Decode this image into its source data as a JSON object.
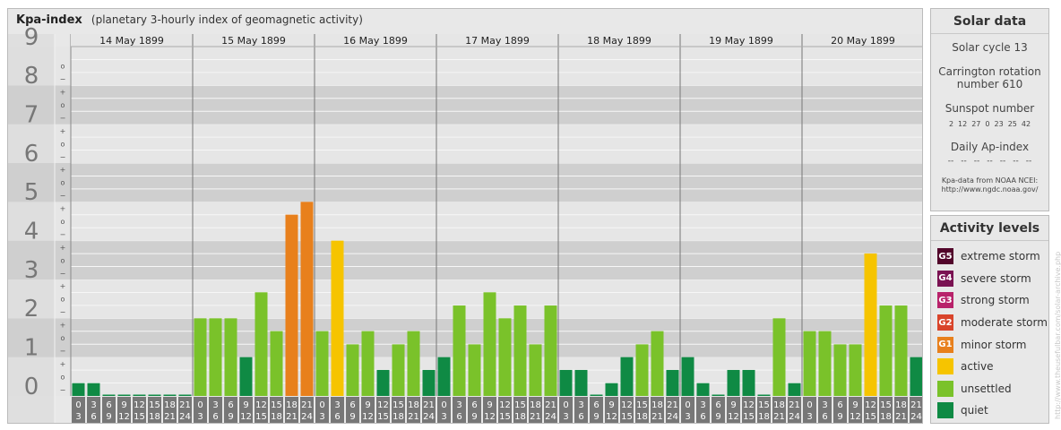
{
  "header": {
    "title": "Kpa-index",
    "subtitle": "(planetary 3-hourly index of geomagnetic activity)"
  },
  "chart_data": {
    "type": "bar",
    "title": "Kpa-index",
    "subtitle": "(planetary 3-hourly index of geomagnetic activity)",
    "ylim": [
      0,
      9
    ],
    "y_tick_labels": [
      "0",
      "1",
      "2",
      "3",
      "4",
      "5",
      "6",
      "7",
      "8",
      "9"
    ],
    "y_minor_labels": [
      "−",
      "o",
      "+"
    ],
    "days": [
      "14 May 1899",
      "15 May 1899",
      "16 May 1899",
      "17 May 1899",
      "18 May 1899",
      "19 May 1899",
      "20 May 1899"
    ],
    "interval_start_labels": [
      "0",
      "3",
      "6",
      "9",
      "12",
      "15",
      "18",
      "21"
    ],
    "interval_end_labels": [
      "3",
      "6",
      "9",
      "12",
      "15",
      "18",
      "21",
      "24"
    ],
    "series": [
      {
        "values": [
          0.33,
          0.33,
          0,
          0,
          0,
          0,
          0,
          0,
          2.0,
          2.0,
          2.0,
          1.0,
          2.67,
          1.67,
          4.67,
          5.0,
          1.67,
          4.0,
          1.33,
          1.67,
          0.67,
          1.33,
          1.67,
          0.67,
          1.0,
          2.33,
          1.33,
          2.67,
          2.0,
          2.33,
          1.33,
          2.33,
          0.67,
          0.67,
          0,
          0.33,
          1.0,
          1.33,
          1.67,
          0.67,
          1.0,
          0.33,
          0,
          0.67,
          0.67,
          0,
          2.0,
          0.33,
          1.67,
          1.67,
          1.33,
          1.33,
          3.67,
          2.33,
          2.33,
          1.0
        ],
        "levels": [
          "quiet",
          "quiet",
          "quiet",
          "quiet",
          "quiet",
          "quiet",
          "quiet",
          "quiet",
          "unsettled",
          "unsettled",
          "unsettled",
          "quiet",
          "unsettled",
          "unsettled",
          "minor",
          "minor",
          "unsettled",
          "active",
          "unsettled",
          "unsettled",
          "quiet",
          "unsettled",
          "unsettled",
          "quiet",
          "quiet",
          "unsettled",
          "unsettled",
          "unsettled",
          "unsettled",
          "unsettled",
          "unsettled",
          "unsettled",
          "quiet",
          "quiet",
          "quiet",
          "quiet",
          "quiet",
          "unsettled",
          "unsettled",
          "quiet",
          "quiet",
          "quiet",
          "quiet",
          "quiet",
          "quiet",
          "quiet",
          "unsettled",
          "quiet",
          "unsettled",
          "unsettled",
          "unsettled",
          "unsettled",
          "active",
          "unsettled",
          "unsettled",
          "quiet"
        ]
      }
    ],
    "level_colors": {
      "quiet": "#0f8a44",
      "unsettled": "#7ac22a",
      "active": "#f6c400",
      "minor": "#e8801c",
      "moderate": "#d9442a",
      "strong": "#b8226a",
      "severe": "#7a1252",
      "extreme": "#52052a"
    },
    "grid": true,
    "legend_position": "right"
  },
  "solar": {
    "title": "Solar data",
    "cycle": "Solar cycle 13",
    "carrington_line1": "Carrington rotation",
    "carrington_line2": "number 610",
    "sunspot_label": "Sunspot number",
    "sunspot_values": [
      "2",
      "12",
      "27",
      "0",
      "23",
      "25",
      "42"
    ],
    "ap_label": "Daily Ap-index",
    "ap_values": [
      "--",
      "--",
      "--",
      "--",
      "--",
      "--",
      "--"
    ],
    "credit_line1": "Kpa-data from NOAA NCEI:",
    "credit_line2": "http://www.ngdc.noaa.gov/"
  },
  "activity": {
    "title": "Activity levels",
    "items": [
      {
        "badge": "G5",
        "label": "extreme storm",
        "color": "#52052a"
      },
      {
        "badge": "G4",
        "label": "severe storm",
        "color": "#7a1252"
      },
      {
        "badge": "G3",
        "label": "strong storm",
        "color": "#b8226a"
      },
      {
        "badge": "G2",
        "label": "moderate storm",
        "color": "#d9442a"
      },
      {
        "badge": "G1",
        "label": "minor storm",
        "color": "#e8801c"
      },
      {
        "badge": "",
        "label": "active",
        "color": "#f6c400"
      },
      {
        "badge": "",
        "label": "unsettled",
        "color": "#7ac22a"
      },
      {
        "badge": "",
        "label": "quiet",
        "color": "#0f8a44"
      }
    ]
  },
  "watermark": "http://www.theusefulbar.com/solar-archive.php"
}
